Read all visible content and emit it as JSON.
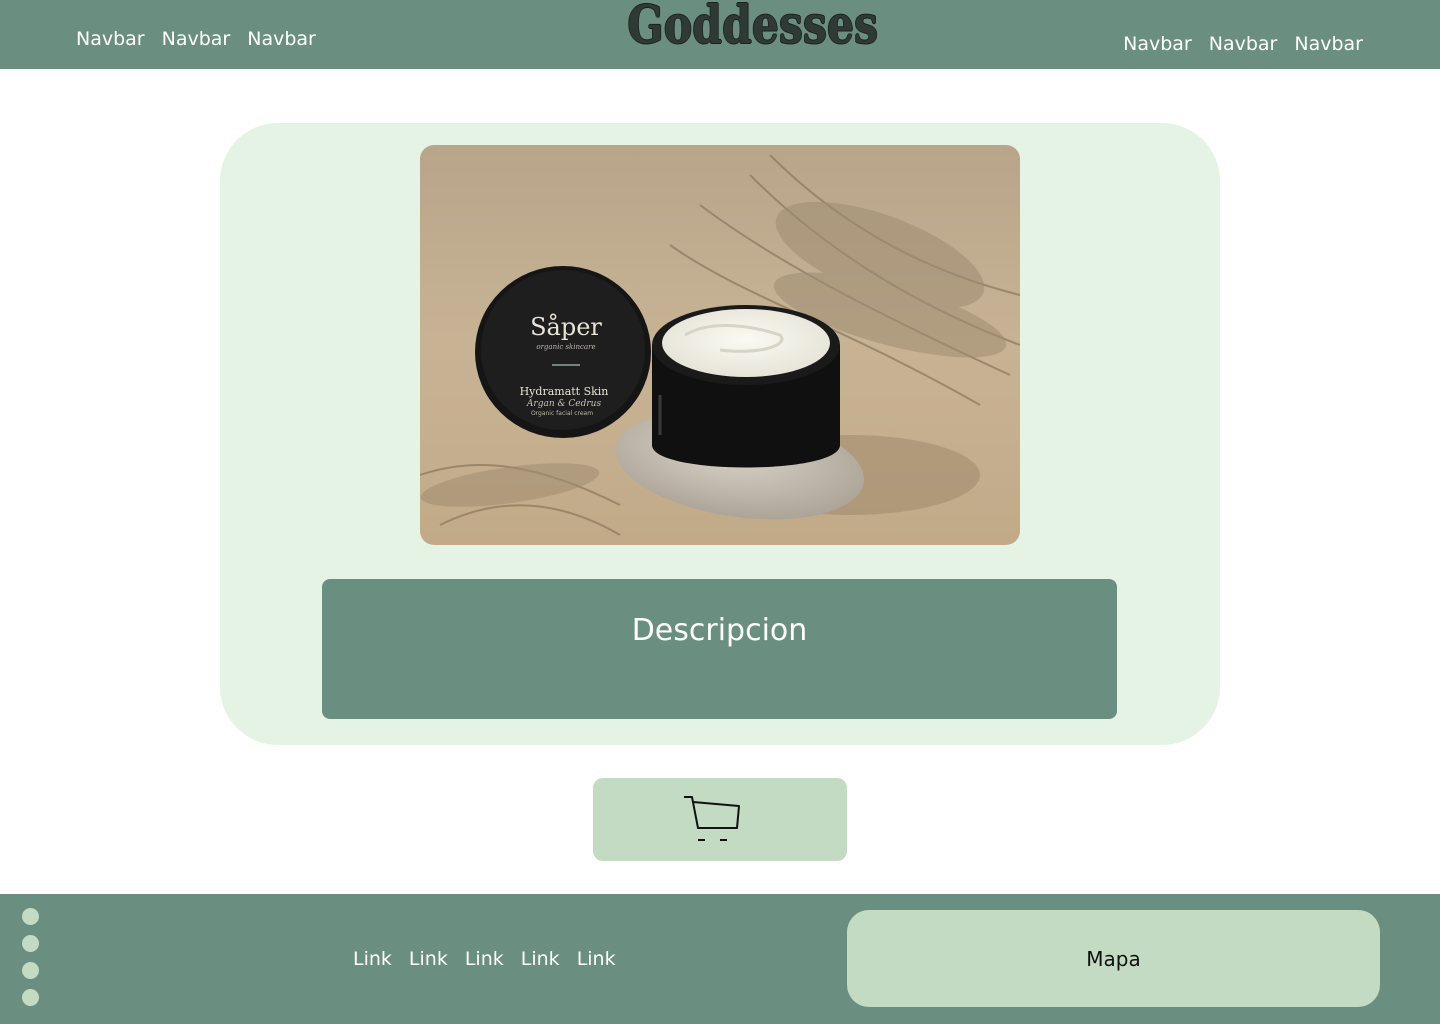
{
  "colors": {
    "header_bg": "#6a8f80",
    "card_bg": "#e5f3e5",
    "accent_light": "#c3dbc3",
    "text_light": "#ffffff"
  },
  "header": {
    "brand": "Goddesses",
    "nav_left": [
      "Navbar",
      "Navbar",
      "Navbar"
    ],
    "nav_right": [
      "Navbar",
      "Navbar",
      "Navbar"
    ]
  },
  "product": {
    "image_label": {
      "brand": "Såper",
      "tagline": "organic skincare",
      "name": "Hydramatt Skin",
      "variant": "Argan & Cedrus",
      "type": "Organic facial cream"
    },
    "description_title": "Descripcion"
  },
  "cart": {
    "icon": "shopping-cart-icon"
  },
  "footer": {
    "dots_count": 4,
    "links": [
      "Link",
      "Link",
      "Link",
      "Link",
      "Link"
    ],
    "map_label": "Mapa"
  }
}
